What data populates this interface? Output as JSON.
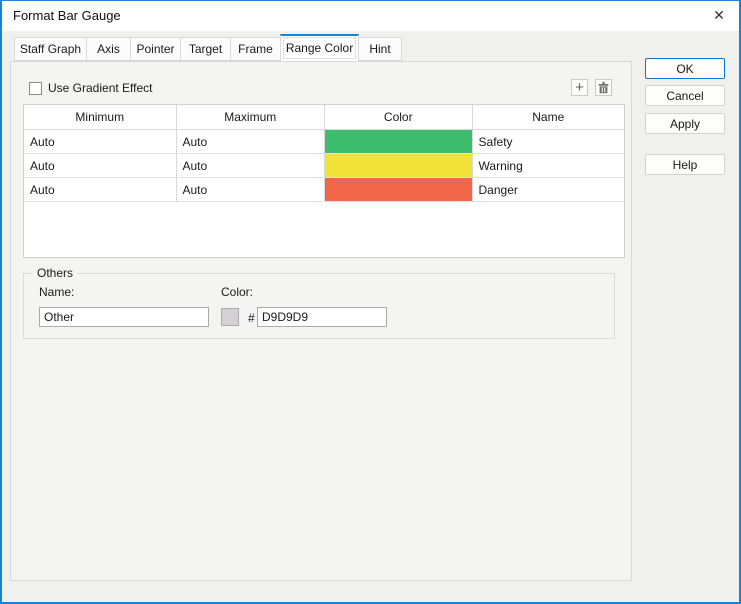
{
  "window": {
    "title": "Format Bar Gauge",
    "close_glyph": "✕"
  },
  "tabs": [
    {
      "label": "Staff Graph",
      "active": false
    },
    {
      "label": "Axis",
      "active": false
    },
    {
      "label": "Pointer",
      "active": false
    },
    {
      "label": "Target",
      "active": false
    },
    {
      "label": "Frame",
      "active": false
    },
    {
      "label": "Range Color",
      "active": true
    },
    {
      "label": "Hint",
      "active": false
    }
  ],
  "content": {
    "gradient_checkbox": {
      "label": "Use Gradient Effect",
      "checked": false
    },
    "toolbar": {
      "add_glyph": "+",
      "delete_icon": "trash"
    },
    "range_table": {
      "headers": [
        "Minimum",
        "Maximum",
        "Color",
        "Name"
      ],
      "rows": [
        {
          "minimum": "Auto",
          "maximum": "Auto",
          "color": "#3CBC6C",
          "name": "Safety"
        },
        {
          "minimum": "Auto",
          "maximum": "Auto",
          "color": "#F0E236",
          "name": "Warning"
        },
        {
          "minimum": "Auto",
          "maximum": "Auto",
          "color": "#F2664B",
          "name": "Danger"
        }
      ]
    },
    "others": {
      "legend": "Others",
      "name_label": "Name:",
      "name_value": "Other",
      "color_label": "Color:",
      "hash_prefix": "#",
      "color_hex_value": "D9D9D9",
      "swatch_color": "#D3D1D3"
    }
  },
  "action_buttons": [
    {
      "label": "OK",
      "primary": true
    },
    {
      "label": "Cancel",
      "primary": false
    },
    {
      "label": "Apply",
      "primary": false
    },
    {
      "label": "Help",
      "primary": false
    }
  ],
  "colors": {
    "accent": "#1883D7",
    "safety": "#3CBC6C",
    "warning": "#F0E236",
    "danger": "#F2664B"
  }
}
